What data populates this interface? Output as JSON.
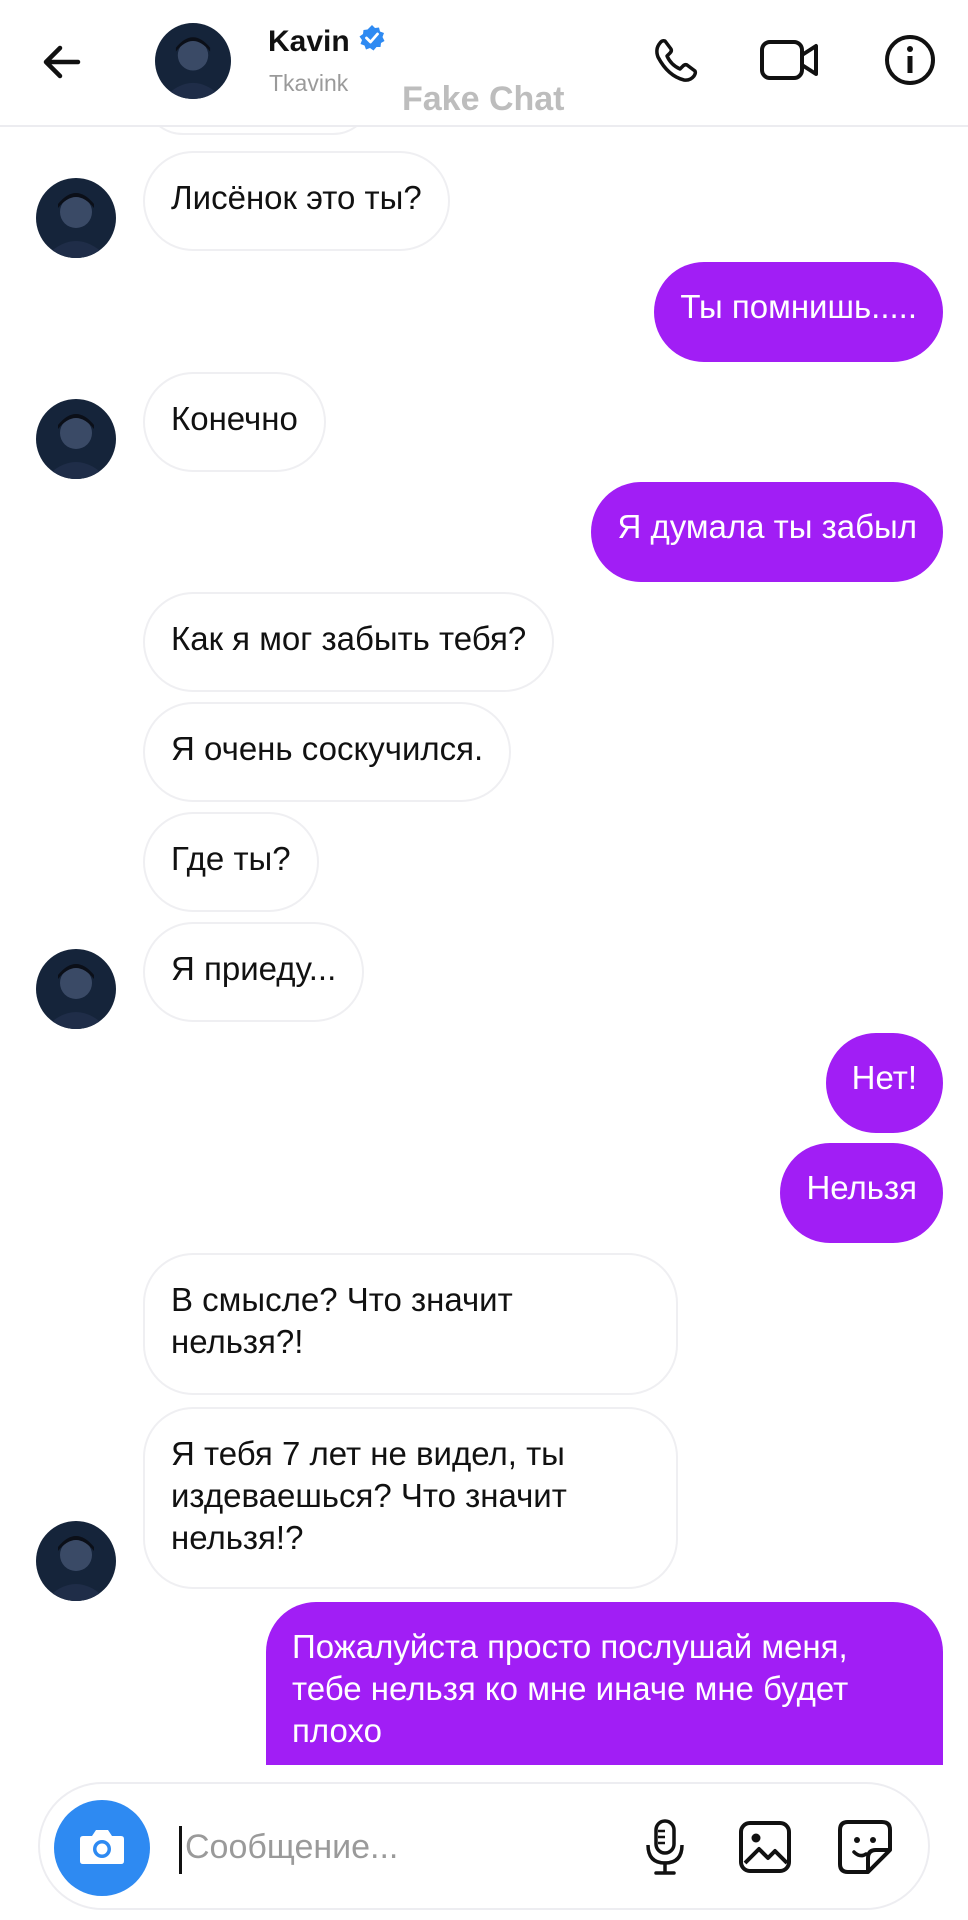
{
  "header": {
    "name": "Kavin",
    "username": "Tkavink",
    "watermark": "Fake Chat",
    "icons": [
      "back-arrow-icon",
      "verified-badge-icon",
      "phone-icon",
      "video-camera-icon",
      "info-icon"
    ]
  },
  "messages": [
    {
      "side": "in",
      "text": "Лисёнок это ты?"
    },
    {
      "side": "out",
      "text": "Ты помнишь....."
    },
    {
      "side": "in",
      "text": "Конечно"
    },
    {
      "side": "out",
      "text": "Я думала ты забыл"
    },
    {
      "side": "in",
      "text": "Как я мог забыть тебя?"
    },
    {
      "side": "in",
      "text": "Я очень соскучился."
    },
    {
      "side": "in",
      "text": "Где ты?"
    },
    {
      "side": "in",
      "text": "Я приеду..."
    },
    {
      "side": "out",
      "text": "Нет!"
    },
    {
      "side": "out",
      "text": "Нельзя"
    },
    {
      "side": "in",
      "text": "В смысле? Что значит\nнельзя?!"
    },
    {
      "side": "in",
      "text": "Я тебя 7 лет не видел, ты\nиздеваешься? Что значит\nнельзя!?"
    },
    {
      "side": "out",
      "text": "Пожалуйста просто послушай меня,\nтебе нельзя ко мне иначе мне будет\nплохо"
    }
  ],
  "composer": {
    "placeholder": "Сообщение...",
    "icons": [
      "camera-icon",
      "microphone-icon",
      "gallery-icon",
      "sticker-icon"
    ]
  },
  "colors": {
    "outgoing_bubble": "#a11ef5",
    "incoming_border": "#efeff2",
    "camera_button": "#2e8af2",
    "verified": "#2e8af2"
  }
}
